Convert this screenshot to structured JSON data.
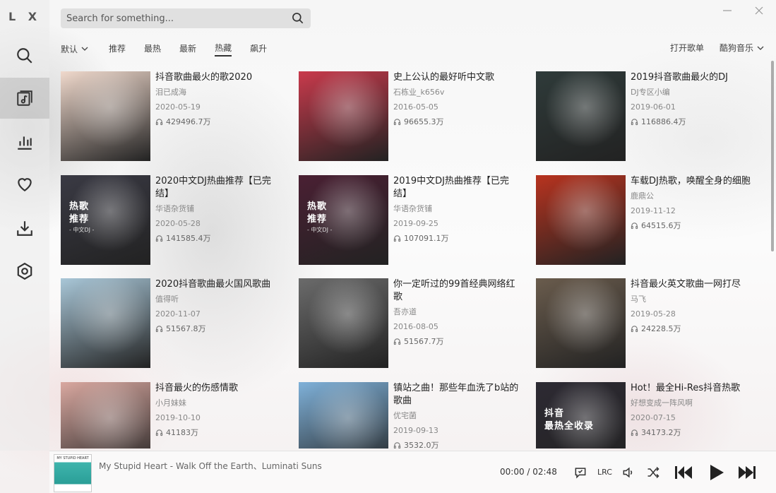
{
  "app": {
    "logo": "L X"
  },
  "search": {
    "placeholder": "Search for something..."
  },
  "tabs": {
    "sort_label": "默认",
    "items": [
      "推荐",
      "最热",
      "最新",
      "热藏",
      "飙升"
    ],
    "open_playlist": "打开歌单",
    "source": "酷狗音乐"
  },
  "playlists": [
    {
      "title": "抖音歌曲最火的歌2020",
      "author": "泪已成海",
      "date": "2020-05-19",
      "plays": "429496.7万"
    },
    {
      "title": "史上公认的最好听中文歌",
      "author": "石栋业_k656v",
      "date": "2016-05-05",
      "plays": "96655.3万"
    },
    {
      "title": "2019抖音歌曲最火的DJ",
      "author": "DJ专区小编",
      "date": "2019-06-01",
      "plays": "116886.4万"
    },
    {
      "title": "2020中文DJ热曲推荐【已完结】",
      "author": "华语杂货铺",
      "date": "2020-05-28",
      "plays": "141585.4万",
      "cover_text": "热歌\n推荐",
      "cover_sub": "- 中文DJ -"
    },
    {
      "title": "2019中文DJ热曲推荐【已完结】",
      "author": "华语杂货铺",
      "date": "2019-09-25",
      "plays": "107091.1万",
      "cover_text": "热歌\n推荐",
      "cover_sub": "- 中文DJ -"
    },
    {
      "title": "车载DJ热歌，唤醒全身的细胞",
      "author": "鹿鼎公",
      "date": "2019-11-12",
      "plays": "64515.6万"
    },
    {
      "title": "2020抖音歌曲最火国风歌曲",
      "author": "值得听",
      "date": "2020-11-07",
      "plays": "51567.8万"
    },
    {
      "title": "你一定听过的99首经典网络红歌",
      "author": "吾亦道",
      "date": "2016-08-05",
      "plays": "51567.7万"
    },
    {
      "title": "抖音最火英文歌曲一网打尽",
      "author": "马飞",
      "date": "2019-05-28",
      "plays": "24228.5万"
    },
    {
      "title": "抖音最火的伤感情歌",
      "author": "小月妹妹",
      "date": "2019-10-10",
      "plays": "41183万"
    },
    {
      "title": "镇站之曲！那些年血洗了b站的歌曲",
      "author": "优宅菌",
      "date": "2019-09-13",
      "plays": "3532.0万"
    },
    {
      "title": "Hot！最全Hi-Res抖音热歌",
      "author": "好想变成一阵风啊",
      "date": "2020-07-15",
      "plays": "34173.2万",
      "cover_text": "抖音\n最热全收录",
      "cover_sub": ""
    }
  ],
  "player": {
    "song": "My Stupid Heart - Walk Off the Earth、Luminati Suns",
    "cover_caption": "MY STUPID HEART",
    "current_time": "00:00",
    "total_time": "02:48",
    "time_sep": " / ",
    "lrc_label": "LRC"
  },
  "colors": {
    "cover_bg": [
      "#f0d9cc",
      "#c93a4c",
      "#2f3b3a",
      "#3a3a44",
      "#4a2033",
      "#b8331f",
      "#a9c7d8",
      "#6b6b6b",
      "#6a5c4d",
      "#d9a8a0",
      "#7fb1d9",
      "#2d2a33"
    ]
  }
}
